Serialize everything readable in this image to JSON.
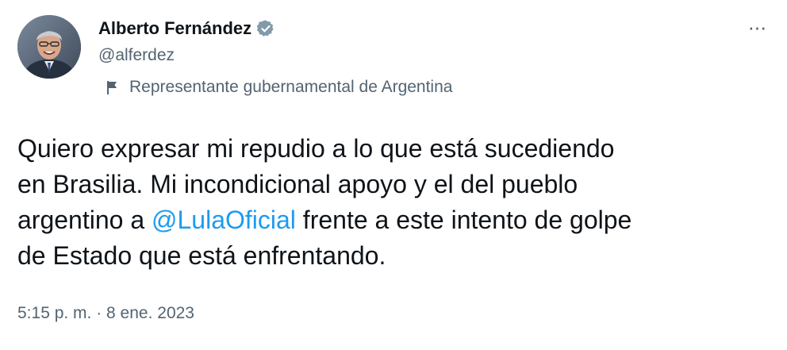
{
  "author": {
    "name": "Alberto Fernández",
    "handle": "@alferdez",
    "verified": true,
    "avatar_icon": "profile-photo"
  },
  "menu": {
    "more_label": "···"
  },
  "label": {
    "icon": "flag-icon",
    "text": "Representante gubernamental de Argentina"
  },
  "tweet": {
    "line1": "Quiero expresar mi repudio a lo que está sucediendo",
    "line2": "en Brasilia. Mi incondicional apoyo y el del pueblo",
    "line3_before": "argentino a ",
    "mention": "@LulaOficial",
    "line3_after": " frente a este intento de golpe",
    "line4": "de Estado que está enfrentando."
  },
  "meta": {
    "timestamp": "5:15 p. m. · 8 ene. 2023"
  },
  "colors": {
    "link": "#1d9bf0",
    "secondary_text": "#536471",
    "verified_badge": "#829aab"
  }
}
